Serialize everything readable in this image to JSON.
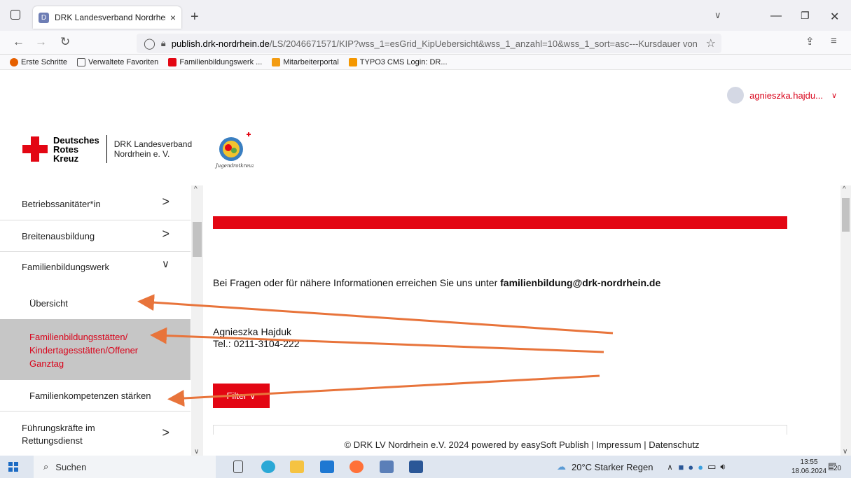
{
  "browser": {
    "tab_title": "DRK Landesverband Nordrhein",
    "tab_close": "×",
    "new_tab": "+",
    "url_host": "publish.drk-nordrhein.de",
    "url_path": "/LS/2046671571/KIP?wss_1=esGrid_KipUebersicht&wss_1_anzahl=10&wss_1_sort=asc---Kursdauer von",
    "bookmarks": [
      "Erste Schritte",
      "Verwaltete Favoriten",
      "Familienbildungswerk ...",
      "Mitarbeiterportal",
      "TYPO3 CMS Login: DR..."
    ]
  },
  "header": {
    "user_name": "agnieszka.hajdu...",
    "logo_line1": "Deutsches",
    "logo_line2": "Rotes",
    "logo_line3": "Kreuz",
    "org_line1": "DRK Landesverband",
    "org_line2": "Nordrhein e. V.",
    "jrk_text": "Jugendrotkreuz"
  },
  "sidebar": {
    "items": [
      {
        "label": "Betriebssanitäter*in",
        "arrow": ">"
      },
      {
        "label": "Breitenausbildung",
        "arrow": ">"
      },
      {
        "label": "Familienbildungswerk",
        "arrow": "∨"
      },
      {
        "label": "Führungskräfte im Rettungsdienst",
        "arrow": ">"
      }
    ],
    "sub_items": [
      "Übersicht",
      "Familienbildungsstätten/ Kindertagesstätten/Offener Ganztag",
      "Familienkompetenzen stärken"
    ]
  },
  "main": {
    "info_text": "Bei Fragen oder für nähere Informationen erreichen Sie uns unter ",
    "info_email": "familienbildung@drk-nordrhein.de",
    "contact_name": "Agnieszka Hajduk",
    "contact_tel": "Tel.: 0211-3104-222",
    "filter_label": "Filter ∨"
  },
  "footer": {
    "text": "© DRK LV Nordrhein e.V. 2024 powered by easySoft Publish  |  Impressum  |  Datenschutz"
  },
  "taskbar": {
    "search_label": "Suchen",
    "weather": "20°C  Starker Regen",
    "time": "13:55",
    "date": "18.06.2024",
    "notifications": "20"
  },
  "colors": {
    "drk_red": "#e30613",
    "arrow_orange": "#e8743b",
    "link_red": "#d9031a"
  }
}
